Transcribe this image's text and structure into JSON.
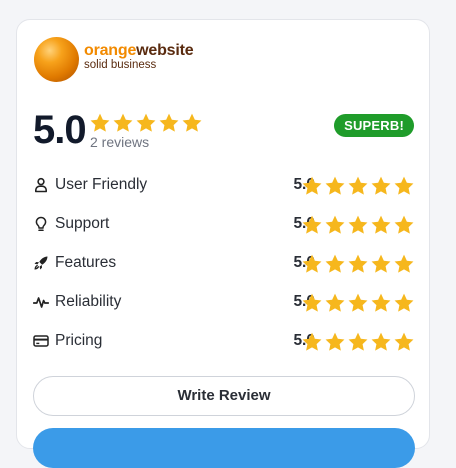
{
  "logo": {
    "name_part1": "orange",
    "name_part2": "website",
    "tagline": "solid business"
  },
  "summary": {
    "score": "5.0",
    "stars": 5,
    "reviews": "2 reviews",
    "badge": "SUPERB!"
  },
  "categories": [
    {
      "label": "User Friendly",
      "value": "5.0",
      "icon": "user-icon"
    },
    {
      "label": "Support",
      "value": "5.0",
      "icon": "lightbulb-icon"
    },
    {
      "label": "Features",
      "value": "5.0",
      "icon": "rocket-icon"
    },
    {
      "label": "Reliability",
      "value": "5.0",
      "icon": "activity-icon"
    },
    {
      "label": "Pricing",
      "value": "5.0",
      "icon": "credit-card-icon"
    }
  ],
  "actions": {
    "write_review": "Write Review"
  },
  "colors": {
    "star": "#f6b71d",
    "badge": "#1f9c2a",
    "primary_button": "#3b9be8",
    "brand_orange": "#f28a00"
  }
}
